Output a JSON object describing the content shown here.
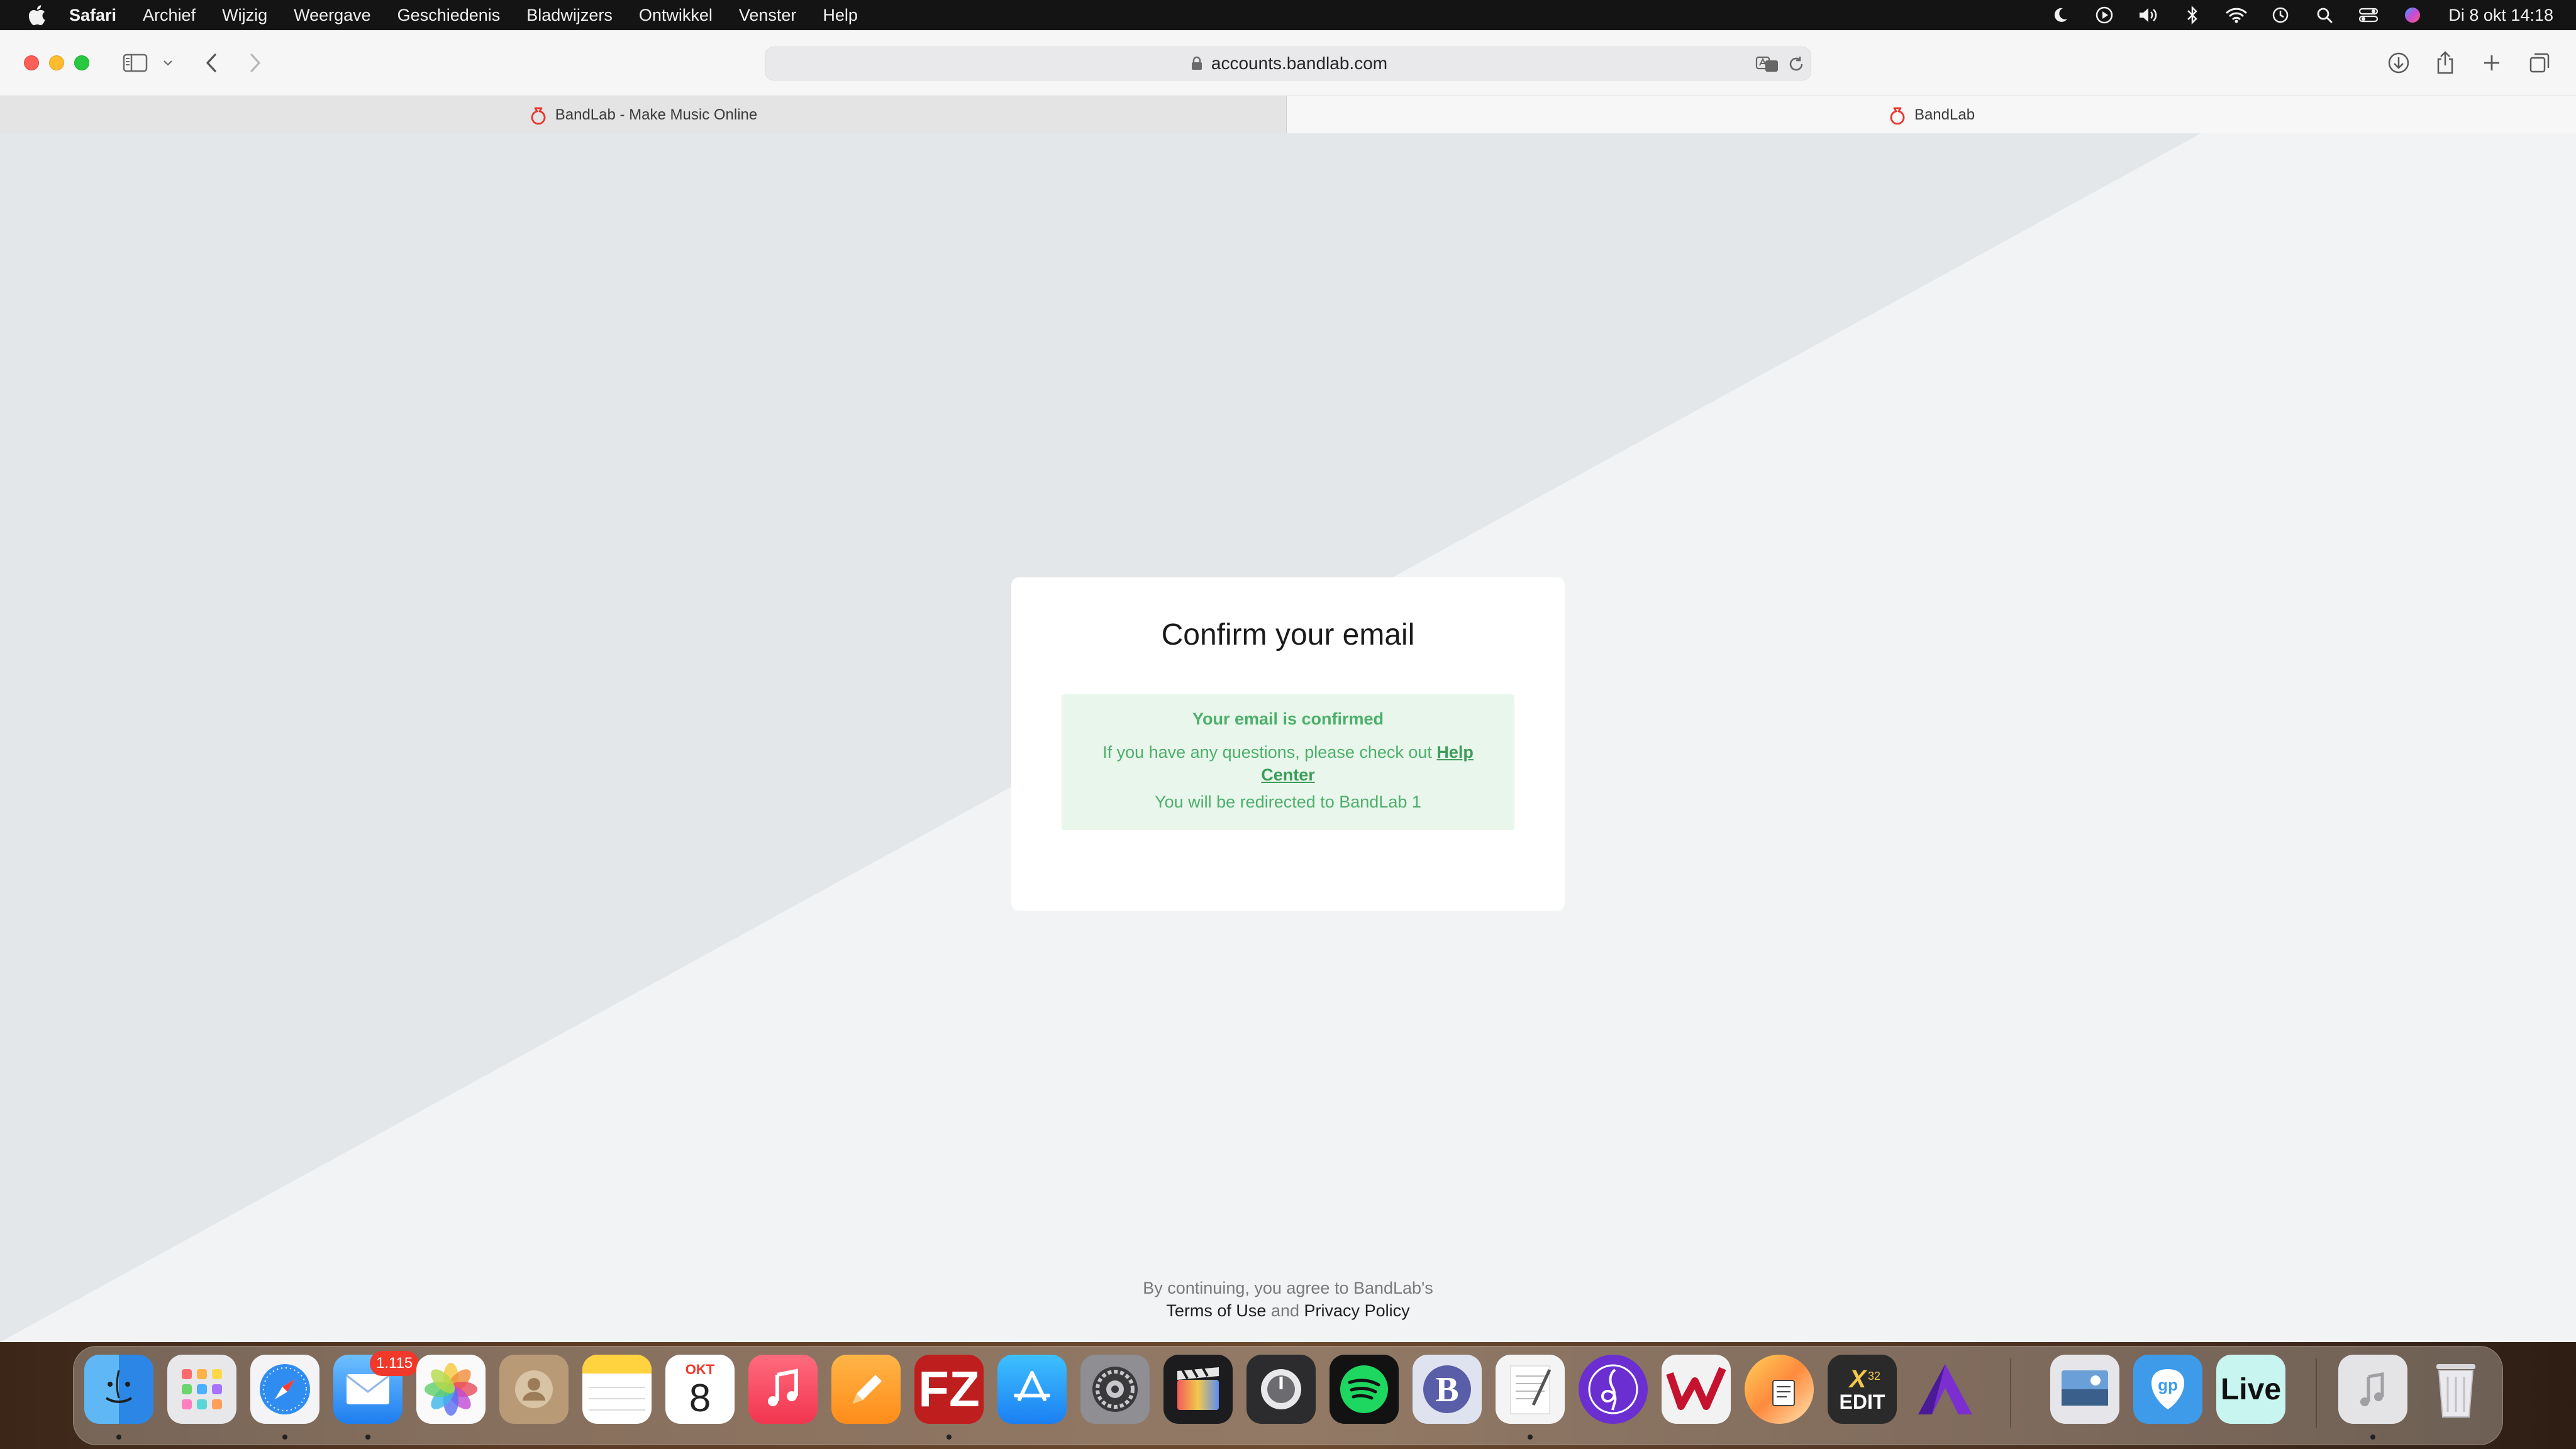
{
  "menubar": {
    "app_name": "Safari",
    "items": [
      "Archief",
      "Wijzig",
      "Weergave",
      "Geschiedenis",
      "Bladwijzers",
      "Ontwikkel",
      "Venster",
      "Help"
    ],
    "clock": "Di 8 okt  14:18"
  },
  "browser": {
    "url": "accounts.bandlab.com",
    "tabs": [
      {
        "title": "BandLab - Make Music Online",
        "active": false
      },
      {
        "title": "BandLab",
        "active": true
      }
    ]
  },
  "card": {
    "title": "Confirm your email",
    "alert_title": "Your email is confirmed",
    "alert_body": "If you have any questions, please check out ",
    "help_link": "Help Center",
    "redirect": "You will be redirected to BandLab 1"
  },
  "footer": {
    "line1": "By continuing, you agree to BandLab's",
    "terms": "Terms of Use",
    "and": "and",
    "privacy": "Privacy Policy"
  },
  "dock": {
    "mail_badge": "1.115",
    "calendar_month": "OKT",
    "calendar_day": "8",
    "live_label": "Live",
    "xedit_label": "EDIT"
  },
  "colors": {
    "success_bg": "#e9f6ec",
    "success_text": "#4caf6a",
    "bandlab_red": "#e8352b"
  }
}
